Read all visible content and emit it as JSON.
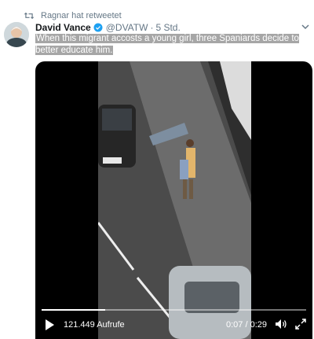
{
  "retweet": {
    "label": "Ragnar hat retweetet",
    "icon": "retweet-icon"
  },
  "tweet": {
    "author_name": "David Vance",
    "handle": "@DVATW",
    "separator": "·",
    "time": "5 Std.",
    "verified": true,
    "text": "When this migrant accosts a young girl, three Spaniards decide to better educate him."
  },
  "video": {
    "views": "121.449 Aufrufe",
    "timecode": "0:07 / 0:29",
    "progress": 0.24,
    "controls": {
      "play": "play-icon",
      "volume": "volume-icon",
      "fullscreen": "fullscreen-icon"
    }
  },
  "colors": {
    "verified": "#1da1f2",
    "muted_text": "#657786",
    "selection": "#a6a6a6"
  }
}
